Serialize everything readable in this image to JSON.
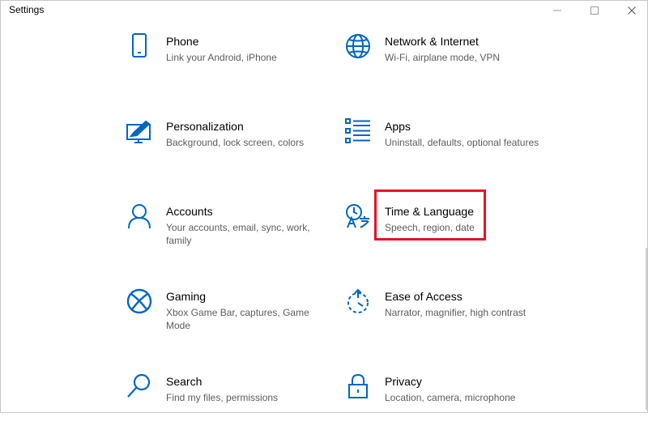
{
  "window": {
    "title": "Settings"
  },
  "accent_color": "#0067c0",
  "highlight_color": "#e81123",
  "tiles": [
    {
      "icon": "phone-icon",
      "name": "Phone",
      "desc": "Link your Android, iPhone"
    },
    {
      "icon": "globe-icon",
      "name": "Network & Internet",
      "desc": "Wi-Fi, airplane mode, VPN"
    },
    {
      "icon": "personalization-icon",
      "name": "Personalization",
      "desc": "Background, lock screen, colors"
    },
    {
      "icon": "apps-list-icon",
      "name": "Apps",
      "desc": "Uninstall, defaults, optional features"
    },
    {
      "icon": "person-icon",
      "name": "Accounts",
      "desc": "Your accounts, email, sync, work, family"
    },
    {
      "icon": "time-language-icon",
      "name": "Time & Language",
      "desc": "Speech, region, date"
    },
    {
      "icon": "xbox-icon",
      "name": "Gaming",
      "desc": "Xbox Game Bar, captures, Game Mode"
    },
    {
      "icon": "ease-of-access-icon",
      "name": "Ease of Access",
      "desc": "Narrator, magnifier, high contrast"
    },
    {
      "icon": "search-icon",
      "name": "Search",
      "desc": "Find my files, permissions"
    },
    {
      "icon": "lock-icon",
      "name": "Privacy",
      "desc": "Location, camera, microphone"
    }
  ]
}
